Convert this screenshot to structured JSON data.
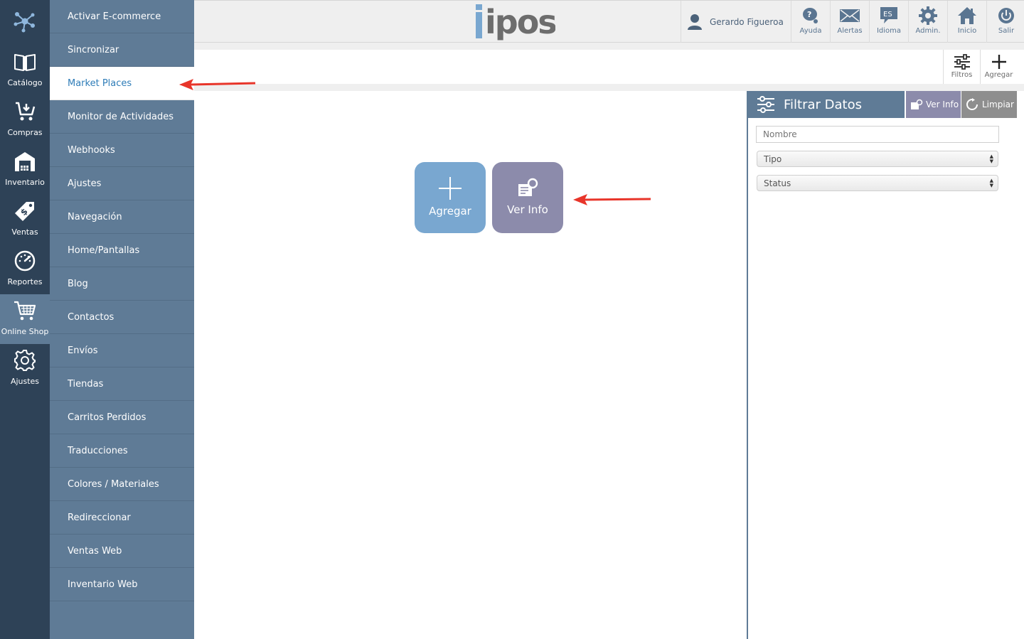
{
  "rail": {
    "items": [
      {
        "label": "Catálogo",
        "icon": "book-icon"
      },
      {
        "label": "Compras",
        "icon": "cart-download-icon"
      },
      {
        "label": "Inventario",
        "icon": "warehouse-icon"
      },
      {
        "label": "Ventas",
        "icon": "price-tag-icon"
      },
      {
        "label": "Reportes",
        "icon": "speedometer-icon"
      },
      {
        "label": "Online Shop",
        "icon": "shopping-cart-icon"
      },
      {
        "label": "Ajustes",
        "icon": "gear-icon"
      }
    ],
    "active": "Online Shop"
  },
  "submenu": {
    "items": [
      "Activar E-commerce",
      "Sincronizar",
      "Market Places",
      "Monitor de Actividades",
      "Webhooks",
      "Ajustes",
      "Navegación",
      "Home/Pantallas",
      "Blog",
      "Contactos",
      "Envíos",
      "Tiendas",
      "Carritos Perdidos",
      "Traducciones",
      "Colores / Materiales",
      "Redireccionar",
      "Ventas Web",
      "Inventario Web"
    ],
    "active": "Market Places"
  },
  "topbar": {
    "brand": "ipos",
    "user_name": "Gerardo Figueroa",
    "buttons": {
      "ayuda": "Ayuda",
      "alertas": "Alertas",
      "idioma": "Idioma",
      "idioma_code": "ES",
      "admin": "Admin.",
      "inicio": "Inicio",
      "salir": "Salir"
    }
  },
  "toolbar": {
    "filtros": "Filtros",
    "agregar": "Agregar"
  },
  "actions": {
    "agregar": "Agregar",
    "ver_info": "Ver Info"
  },
  "filter_panel": {
    "title": "Filtrar Datos",
    "ver_info": "Ver Info",
    "limpiar": "Limpiar",
    "nombre_placeholder": "Nombre",
    "tipo": "Tipo",
    "status": "Status"
  },
  "colors": {
    "rail_bg": "#2e4257",
    "submenu_bg": "#5f7b96",
    "active_text": "#2f7db8",
    "agregar_btn": "#79a7d0",
    "ver_info_btn": "#8c8bab",
    "annotation_arrow": "#e8352a"
  }
}
